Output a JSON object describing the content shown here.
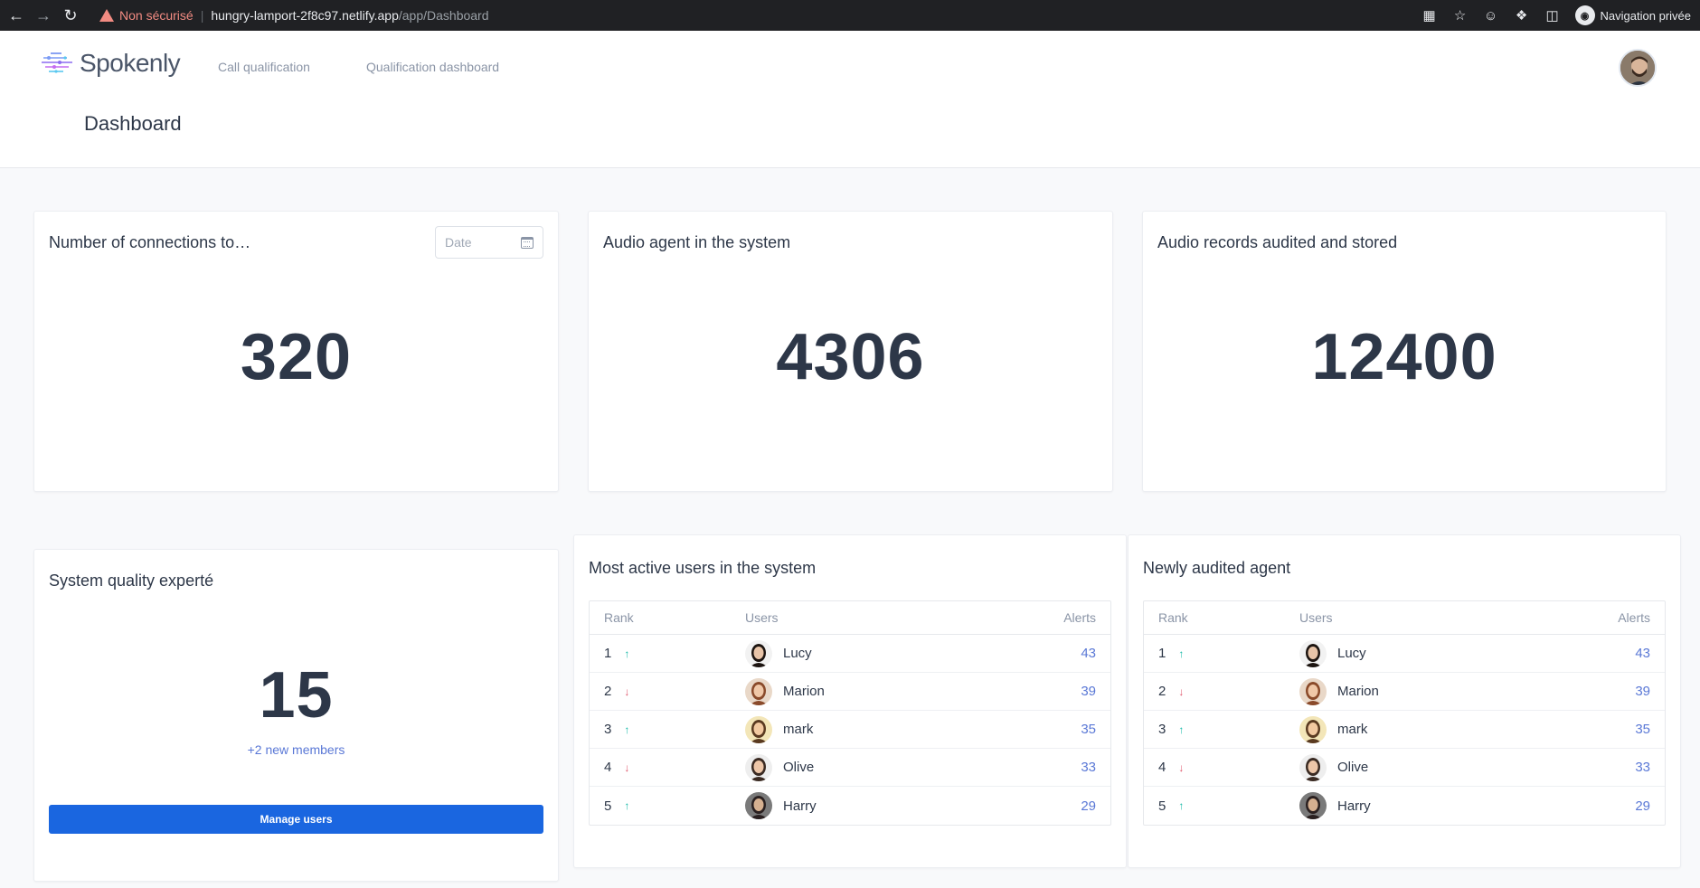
{
  "browser": {
    "warning": "Non sécurisé",
    "url_host": "hungry-lamport-2f8c97.netlify.app",
    "url_path": "/app/Dashboard",
    "private_label": "Navigation privée"
  },
  "header": {
    "logo_text": "Spokenly",
    "nav": [
      "Call qualification",
      "Qualification dashboard"
    ],
    "page_title": "Dashboard"
  },
  "stats": {
    "connections": {
      "title": "Number of connections to…",
      "date_placeholder": "Date",
      "value": "320"
    },
    "audio_agent": {
      "title": "Audio agent in the system",
      "value": "4306"
    },
    "audio_records": {
      "title": "Audio records audited and stored",
      "value": "12400"
    }
  },
  "quality": {
    "title": "System quality experté",
    "value": "15",
    "new_members": "+2 new members",
    "button": "Manage users"
  },
  "active_users": {
    "title": "Most active users in the system",
    "headers": {
      "rank": "Rank",
      "users": "Users",
      "alerts": "Alerts"
    },
    "rows": [
      {
        "rank": "1",
        "trend": "up",
        "name": "Lucy",
        "alerts": "43"
      },
      {
        "rank": "2",
        "trend": "down",
        "name": "Marion",
        "alerts": "39"
      },
      {
        "rank": "3",
        "trend": "up",
        "name": "mark",
        "alerts": "35"
      },
      {
        "rank": "4",
        "trend": "down",
        "name": "Olive",
        "alerts": "33"
      },
      {
        "rank": "5",
        "trend": "up",
        "name": "Harry",
        "alerts": "29"
      }
    ]
  },
  "audited_agents": {
    "title": "Newly audited agent",
    "headers": {
      "rank": "Rank",
      "users": "Users",
      "alerts": "Alerts"
    },
    "rows": [
      {
        "rank": "1",
        "trend": "up",
        "name": "Lucy",
        "alerts": "43"
      },
      {
        "rank": "2",
        "trend": "down",
        "name": "Marion",
        "alerts": "39"
      },
      {
        "rank": "3",
        "trend": "up",
        "name": "mark",
        "alerts": "35"
      },
      {
        "rank": "4",
        "trend": "down",
        "name": "Olive",
        "alerts": "33"
      },
      {
        "rank": "5",
        "trend": "up",
        "name": "Harry",
        "alerts": "29"
      }
    ]
  },
  "colors": {
    "accent": "#1a66e0",
    "link": "#5a78d6",
    "up": "#14b8a6",
    "down": "#e0566b",
    "text": "#2d3748"
  }
}
